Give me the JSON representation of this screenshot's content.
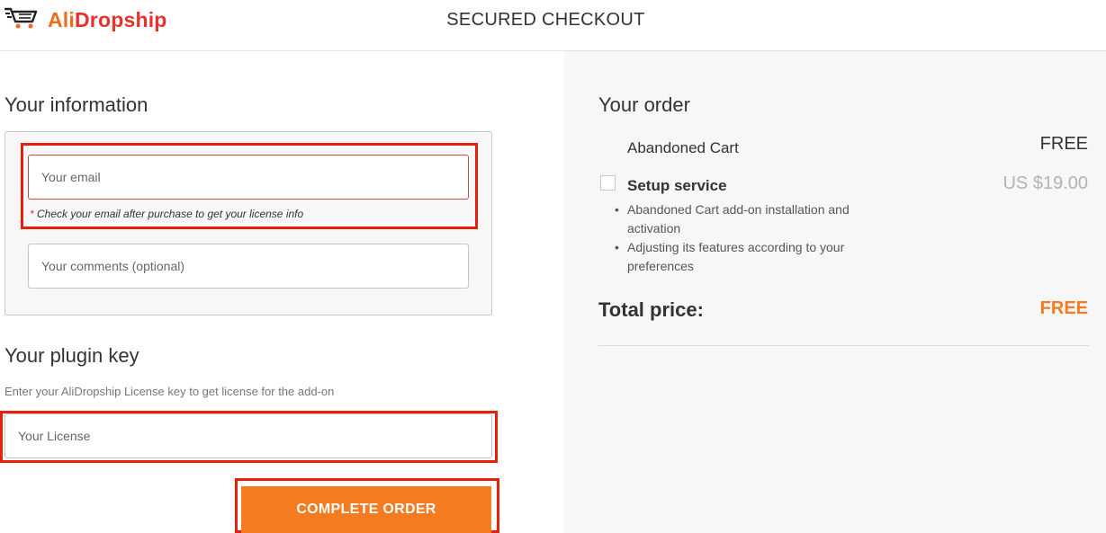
{
  "header": {
    "logo_part1": "Ali",
    "logo_part2": "Dropship",
    "title": "SECURED CHECKOUT"
  },
  "info": {
    "heading": "Your information",
    "email_placeholder": "Your email",
    "email_hint_star": "*",
    "email_hint": "Check your email after purchase to get your license info",
    "comments_placeholder": "Your comments (optional)"
  },
  "plugin": {
    "heading": "Your plugin key",
    "description": "Enter your AliDropship License key to get license for the add-on",
    "license_placeholder": "Your License",
    "submit_label": "COMPLETE ORDER"
  },
  "order": {
    "heading": "Your order",
    "product_name": "Abandoned Cart",
    "product_price": "FREE",
    "setup_label": "Setup service",
    "setup_price": "US $19.00",
    "setup_bullets": [
      "Abandoned Cart add-on installation and activation",
      "Adjusting its features according to your preferences"
    ],
    "total_label": "Total price:",
    "total_value": "FREE"
  },
  "colors": {
    "accent_orange": "#f47b20",
    "highlight_red": "#e5200d",
    "logo_red": "#e5322d"
  }
}
